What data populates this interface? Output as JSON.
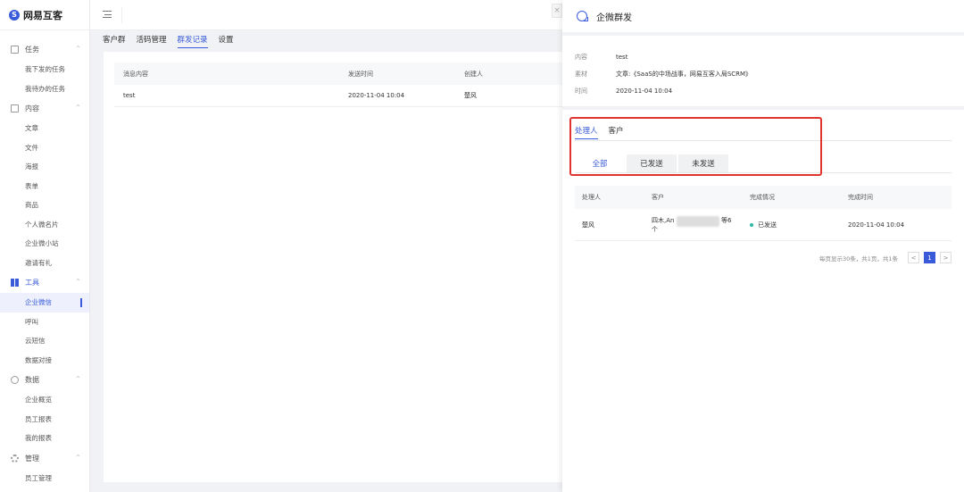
{
  "app": {
    "logo_text": "网易互客"
  },
  "sidebar": {
    "groups": [
      {
        "label": "任务",
        "items": [
          "我下发的任务",
          "我待办的任务"
        ]
      },
      {
        "label": "内容",
        "items": [
          "文章",
          "文件",
          "海报",
          "表单",
          "商品",
          "个人微名片",
          "企业微小站",
          "邀请有礼"
        ]
      },
      {
        "label": "工具",
        "items": [
          "企业微信",
          "呼叫",
          "云短信",
          "数据对接"
        ]
      },
      {
        "label": "数据",
        "items": [
          "企业概览",
          "员工报表",
          "我的报表"
        ]
      },
      {
        "label": "管理",
        "items": [
          "员工管理"
        ]
      }
    ]
  },
  "tabs": [
    "客户群",
    "活码管理",
    "群发记录",
    "设置"
  ],
  "main_table": {
    "headers": [
      "消息内容",
      "发送时间",
      "创建人"
    ],
    "rows": [
      {
        "content": "test",
        "time": "2020-11-04 10:04",
        "creator": "楚风"
      }
    ]
  },
  "drawer": {
    "title": "企微群发",
    "info": [
      {
        "key": "内容",
        "value": "test"
      },
      {
        "key": "素材",
        "value": "文章:《SaaS的中场战事，网易互客入局SCRM》"
      },
      {
        "key": "时间",
        "value": "2020-11-04 10:04"
      }
    ],
    "subtabs": [
      "处理人",
      "客户"
    ],
    "filters": [
      "全部",
      "已发送",
      "未发送"
    ],
    "table": {
      "headers": [
        "处理人",
        "客户",
        "完成情况",
        "完成时间"
      ],
      "rows": [
        {
          "handler": "楚风",
          "customer_a": "四木,An",
          "customer_b": "等6",
          "customer_c": "个",
          "status": "已发送",
          "time": "2020-11-04 10:04"
        }
      ]
    },
    "pager": {
      "summary": "每页显示30条，共1页，共1条",
      "page": "1",
      "prev": "<",
      "next": ">"
    },
    "close": "×"
  },
  "colors": {
    "accent": "#3a5bd9",
    "highlight": "#e0342e",
    "status_sent": "#2db7a4"
  }
}
